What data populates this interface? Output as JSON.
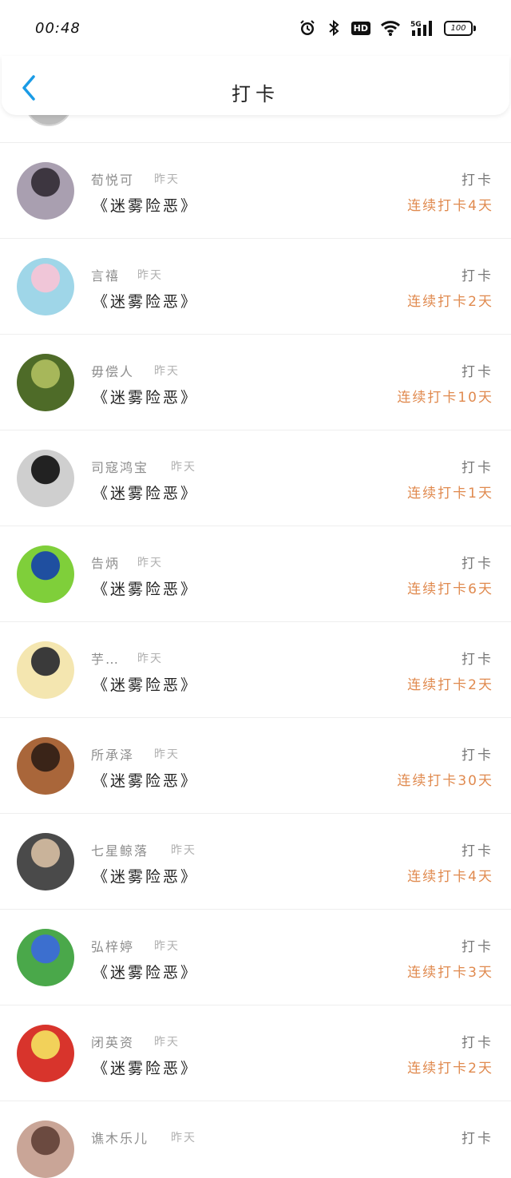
{
  "status": {
    "time": "00:48",
    "battery": "100",
    "hd": "HD",
    "network": "5G"
  },
  "header": {
    "title": "打卡"
  },
  "rows": [
    {
      "name": "荀悦可",
      "when": "昨天",
      "book": "《迷雾险恶》",
      "action": "打卡",
      "streak": "连续打卡4天",
      "avatar": "#a99fb0",
      "avatar2": "#3d3640"
    },
    {
      "name": "言禧",
      "when": "昨天",
      "book": "《迷雾险恶》",
      "action": "打卡",
      "streak": "连续打卡2天",
      "avatar": "#9fd6e8",
      "avatar2": "#f0c6d8"
    },
    {
      "name": "毋偿人",
      "when": "昨天",
      "book": "《迷雾险恶》",
      "action": "打卡",
      "streak": "连续打卡10天",
      "avatar": "#4e6b28",
      "avatar2": "#a7b75a"
    },
    {
      "name": "司寇鸿宝",
      "when": "昨天",
      "book": "《迷雾险恶》",
      "action": "打卡",
      "streak": "连续打卡1天",
      "avatar": "#cfcfcf",
      "avatar2": "#222222"
    },
    {
      "name": "告炳",
      "when": "昨天",
      "book": "《迷雾险恶》",
      "action": "打卡",
      "streak": "连续打卡6天",
      "avatar": "#7fcf3a",
      "avatar2": "#1f4fa0"
    },
    {
      "name": "芋…",
      "when": "昨天",
      "book": "《迷雾险恶》",
      "action": "打卡",
      "streak": "连续打卡2天",
      "avatar": "#f4e6b0",
      "avatar2": "#3a3a3a"
    },
    {
      "name": "所承泽",
      "when": "昨天",
      "book": "《迷雾险恶》",
      "action": "打卡",
      "streak": "连续打卡30天",
      "avatar": "#a9663a",
      "avatar2": "#3a2418"
    },
    {
      "name": "七星鲸落",
      "when": "昨天",
      "book": "《迷雾险恶》",
      "action": "打卡",
      "streak": "连续打卡4天",
      "avatar": "#4a4a4a",
      "avatar2": "#c9b39a"
    },
    {
      "name": "弘梓婷",
      "when": "昨天",
      "book": "《迷雾险恶》",
      "action": "打卡",
      "streak": "连续打卡3天",
      "avatar": "#4aa84a",
      "avatar2": "#3c6fcf"
    },
    {
      "name": "闭英资",
      "when": "昨天",
      "book": "《迷雾险恶》",
      "action": "打卡",
      "streak": "连续打卡2天",
      "avatar": "#d8342c",
      "avatar2": "#f2d15a"
    }
  ],
  "partial_row": {
    "name": "谯木乐儿",
    "when": "昨天",
    "action": "打卡",
    "avatar": "#c9a597",
    "avatar2": "#6b4a40"
  },
  "colors": {
    "accent_back": "#1a9be6",
    "streak": "#e08a4f"
  }
}
